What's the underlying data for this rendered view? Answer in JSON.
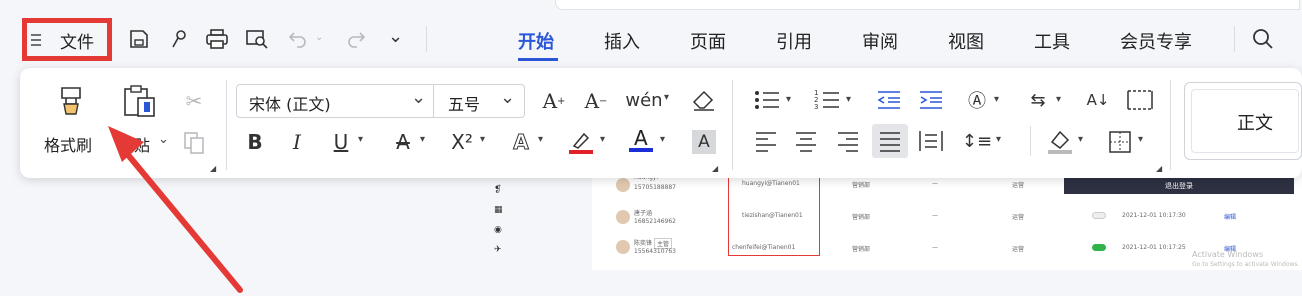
{
  "topbar": {
    "file_label": "文件",
    "tabs": [
      "开始",
      "插入",
      "页面",
      "引用",
      "审阅",
      "视图",
      "工具",
      "会员专享"
    ],
    "active_tab": "开始"
  },
  "ribbon": {
    "format_painter_label": "格式刷",
    "paste_label": "粘贴",
    "font_name": "宋体 (正文)",
    "font_size": "五号",
    "style_preview": "正文",
    "superscript_label": "X²"
  },
  "doc": {
    "rows": [
      {
        "name": "huangyi",
        "phone": "15705188887",
        "email": "huangyi@Tianen01",
        "dept": "营销部",
        "dash": "—",
        "role": "运营"
      },
      {
        "name": "唐子涵",
        "phone": "16852146962",
        "email": "tiezishan@Tianen01",
        "dept": "营销部",
        "dash": "—",
        "role": "运营",
        "date": "2021-12-01 10:17:30",
        "action": "编辑"
      },
      {
        "name": "陈奕锋",
        "tag": "主管",
        "phone": "15564310763",
        "email": "chenfeifei@Tianen01",
        "dept": "营销部",
        "dash": "—",
        "role": "运营",
        "date": "2021-12-01 10:17:25",
        "action": "编辑"
      }
    ],
    "logout_btn": "退出登录",
    "watermark_line1": "Activate Windows",
    "watermark_line2": "Go to Settings to activate Windows."
  },
  "colors": {
    "accent": "#2a57d7",
    "highlight": "#e53935",
    "font_red": "#e0202a",
    "font_blue": "#1a2fd6"
  }
}
